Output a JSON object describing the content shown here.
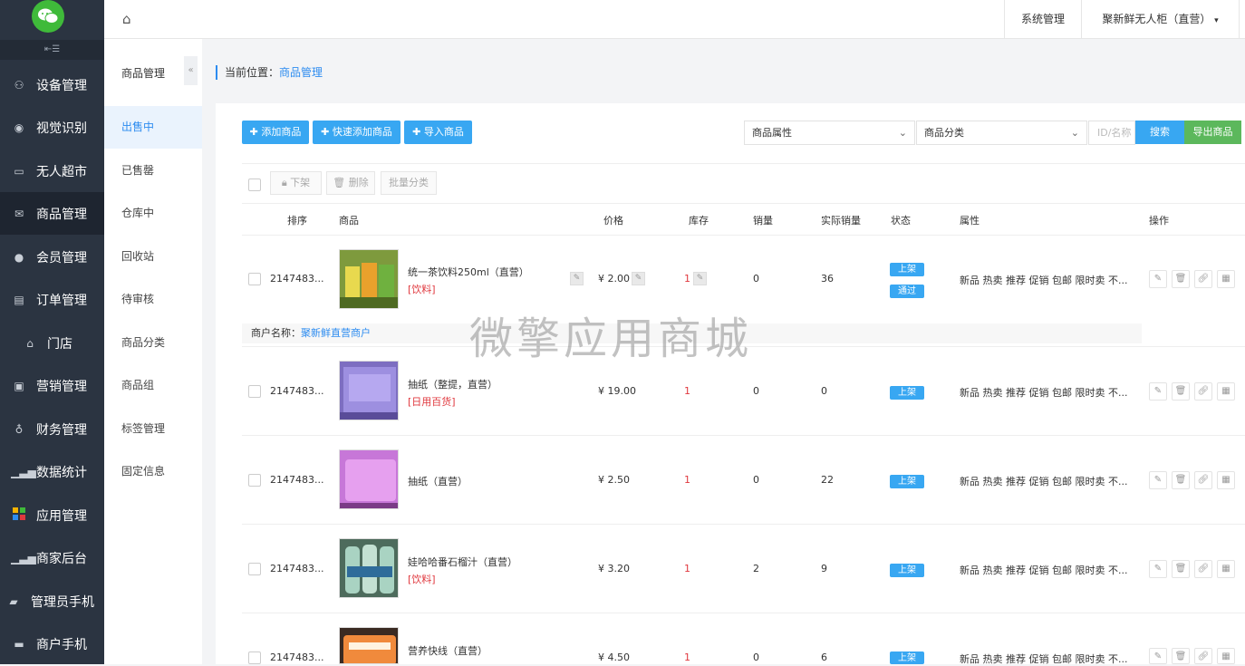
{
  "sidebar": {
    "items": [
      {
        "label": "设备管理",
        "icon": "device-icon"
      },
      {
        "label": "视觉识别",
        "icon": "eye-icon"
      },
      {
        "label": "无人超市",
        "icon": "monitor-icon"
      },
      {
        "label": "商品管理",
        "icon": "box-icon"
      },
      {
        "label": "会员管理",
        "icon": "user-icon"
      },
      {
        "label": "订单管理",
        "icon": "document-icon"
      },
      {
        "label": "门店",
        "icon": "store-icon"
      },
      {
        "label": "营销管理",
        "icon": "gift-icon"
      },
      {
        "label": "财务管理",
        "icon": "money-bag-icon"
      },
      {
        "label": "数据统计",
        "icon": "bar-chart-icon"
      },
      {
        "label": "应用管理",
        "icon": "apps-icon"
      },
      {
        "label": "商家后台",
        "icon": "bar-chart-icon"
      },
      {
        "label": "管理员手机",
        "icon": "car-icon"
      },
      {
        "label": "商户手机",
        "icon": "card-icon"
      }
    ]
  },
  "subnav": {
    "title": "商品管理",
    "items": [
      "出售中",
      "已售罄",
      "仓库中",
      "回收站",
      "待审核",
      "商品分类",
      "商品组",
      "标签管理",
      "固定信息"
    ]
  },
  "topbar": {
    "system": "系统管理",
    "store": "聚新鲜无人柜（直营）"
  },
  "breadcrumb": {
    "label": "当前位置：",
    "current": "商品管理"
  },
  "toolbar": {
    "add": "添加商品",
    "quick_add": "快速添加商品",
    "import": "导入商品",
    "attr_select": "商品属性",
    "category_select": "商品分类",
    "search_placeholder": "ID/名称",
    "search": "搜索",
    "export": "导出商品"
  },
  "bulk": {
    "off_shelf": "下架",
    "delete": "删除",
    "batch_category": "批量分类"
  },
  "table": {
    "headers": {
      "sort": "排序",
      "product": "商品",
      "price": "价格",
      "stock": "库存",
      "sales": "销量",
      "actual_sales": "实际销量",
      "status": "状态",
      "attrs": "属性",
      "ops": "操作"
    },
    "rows": [
      {
        "id": "2147483...",
        "name": "统一茶饮料250ml（直营）",
        "category": "[饮料]",
        "price": "¥ 2.00",
        "stock": "1",
        "sales": "0",
        "actual": "36",
        "status": "上架",
        "status2": "通过",
        "attrs": "新品 热卖 推荐 促销 包邮 限时卖 不..."
      },
      {
        "id": "2147483...",
        "name": "抽纸（整提，直营）",
        "category": "[日用百货]",
        "price": "¥ 19.00",
        "stock": "1",
        "sales": "0",
        "actual": "0",
        "status": "上架",
        "attrs": "新品 热卖 推荐 促销 包邮 限时卖 不..."
      },
      {
        "id": "2147483...",
        "name": "抽纸（直营）",
        "category": "",
        "price": "¥ 2.50",
        "stock": "1",
        "sales": "0",
        "actual": "22",
        "status": "上架",
        "attrs": "新品 热卖 推荐 促销 包邮 限时卖 不..."
      },
      {
        "id": "2147483...",
        "name": "娃哈哈番石榴汁（直营）",
        "category": "[饮料]",
        "price": "¥ 3.20",
        "stock": "1",
        "sales": "2",
        "actual": "9",
        "status": "上架",
        "attrs": "新品 热卖 推荐 促销 包邮 限时卖 不..."
      },
      {
        "id": "2147483...",
        "name": "营养快线（直营）",
        "category": "",
        "price": "¥ 4.50",
        "stock": "1",
        "sales": "0",
        "actual": "6",
        "status": "上架",
        "attrs": "新品 热卖 推荐 促销 包邮 限时卖 不..."
      }
    ]
  },
  "merchant": {
    "label": "商户名称：",
    "name": "聚新鲜直营商户"
  },
  "watermark": "微擎应用商城",
  "colors": {
    "accent": "#38a7f2",
    "export": "#5cb85c",
    "sidebar": "#2b3441"
  }
}
